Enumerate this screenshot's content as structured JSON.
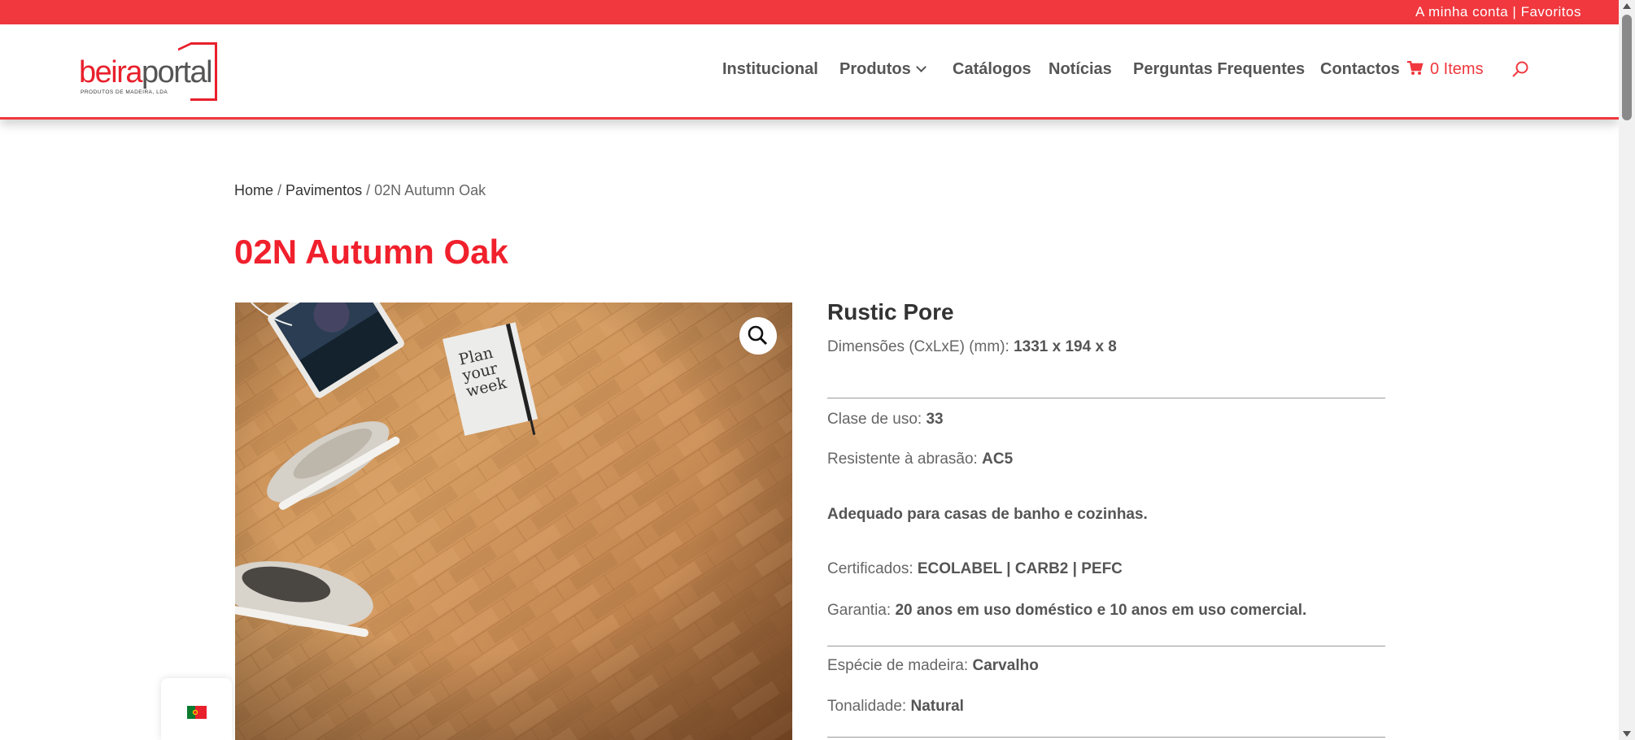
{
  "topbar": {
    "account_link": "A minha conta",
    "separator": "|",
    "favorites_link": "Favoritos"
  },
  "logo": {
    "part1": "beira",
    "part2": "portal",
    "tagline": "PRODUTOS DE MADEIRA, LDA"
  },
  "nav": {
    "items": [
      {
        "label": "Institucional"
      },
      {
        "label": "Produtos"
      },
      {
        "label": "Catálogos"
      },
      {
        "label": "Notícias"
      },
      {
        "label": "Perguntas Frequentes"
      },
      {
        "label": "Contactos"
      }
    ],
    "cart_label": "0 Items"
  },
  "breadcrumb": {
    "home": "Home",
    "sep1": " / ",
    "category": "Pavimentos",
    "sep2": " / ",
    "current": "02N Autumn Oak"
  },
  "product": {
    "title": "02N Autumn Oak",
    "image_text": "Plan your week",
    "subtitle": "Rustic Pore",
    "specs": [
      {
        "label": "Dimensões (CxLxE) (mm): ",
        "value": "1331 x 194 x 8"
      },
      {
        "label": "Clase de uso: ",
        "value": "33"
      },
      {
        "label": "Resistente à abrasão: ",
        "value": "AC5"
      },
      {
        "label": "",
        "value": "Adequado para casas de banho e cozinhas."
      },
      {
        "label": "Certificados: ",
        "value": "ECOLABEL | CARB2 | PEFC"
      },
      {
        "label": "Garantia: ",
        "value": "20 anos em uso doméstico e 10 anos em uso comercial."
      },
      {
        "label": "Espécie de madeira: ",
        "value": "Carvalho"
      },
      {
        "label": "Tonalidade: ",
        "value": "Natural"
      }
    ]
  },
  "colors": {
    "accent": "#f0383e",
    "title": "#f0202c"
  },
  "icons": [
    "cart-icon",
    "search-icon",
    "zoom-icon",
    "chevron-down-icon",
    "portugal-flag-icon"
  ]
}
